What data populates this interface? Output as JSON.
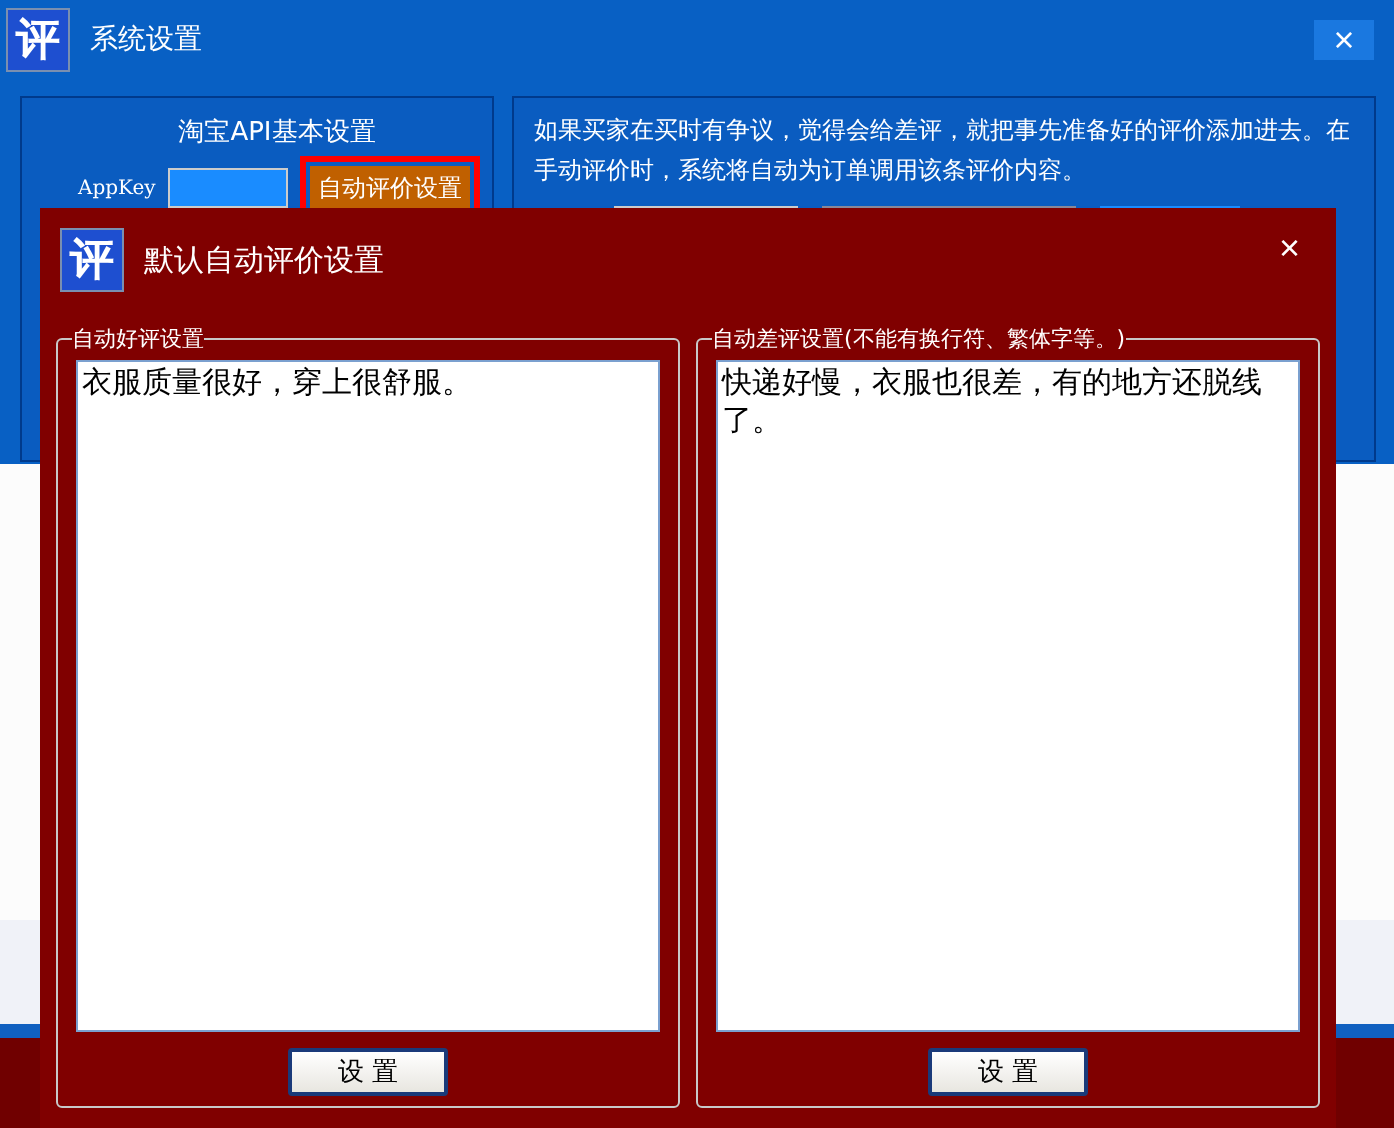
{
  "window": {
    "title": "系统设置",
    "icon": "评"
  },
  "api_panel": {
    "title": "淘宝API基本设置",
    "appkey_label": "AppKey",
    "auto_button": {
      "label": "自动评价设置",
      "highlighted": true
    }
  },
  "info_panel": {
    "text": "如果买家在买时有争议，觉得会给差评，就把事先准备好的评价添加进去。在手动评价时，系统将自动为订单调用该条评价内容。"
  },
  "dialog": {
    "title": "默认自动评价设置",
    "icon": "评",
    "close": "×",
    "groups": [
      {
        "legend": "自动好评设置",
        "text": "衣服质量很好，穿上很舒服。",
        "button": "设 置"
      },
      {
        "legend": "自动差评设置(不能有换行符、繁体字等。)",
        "text": "快递好慢，衣服也很差，有的地方还脱线了。",
        "button": "设 置"
      }
    ]
  },
  "close": "×"
}
